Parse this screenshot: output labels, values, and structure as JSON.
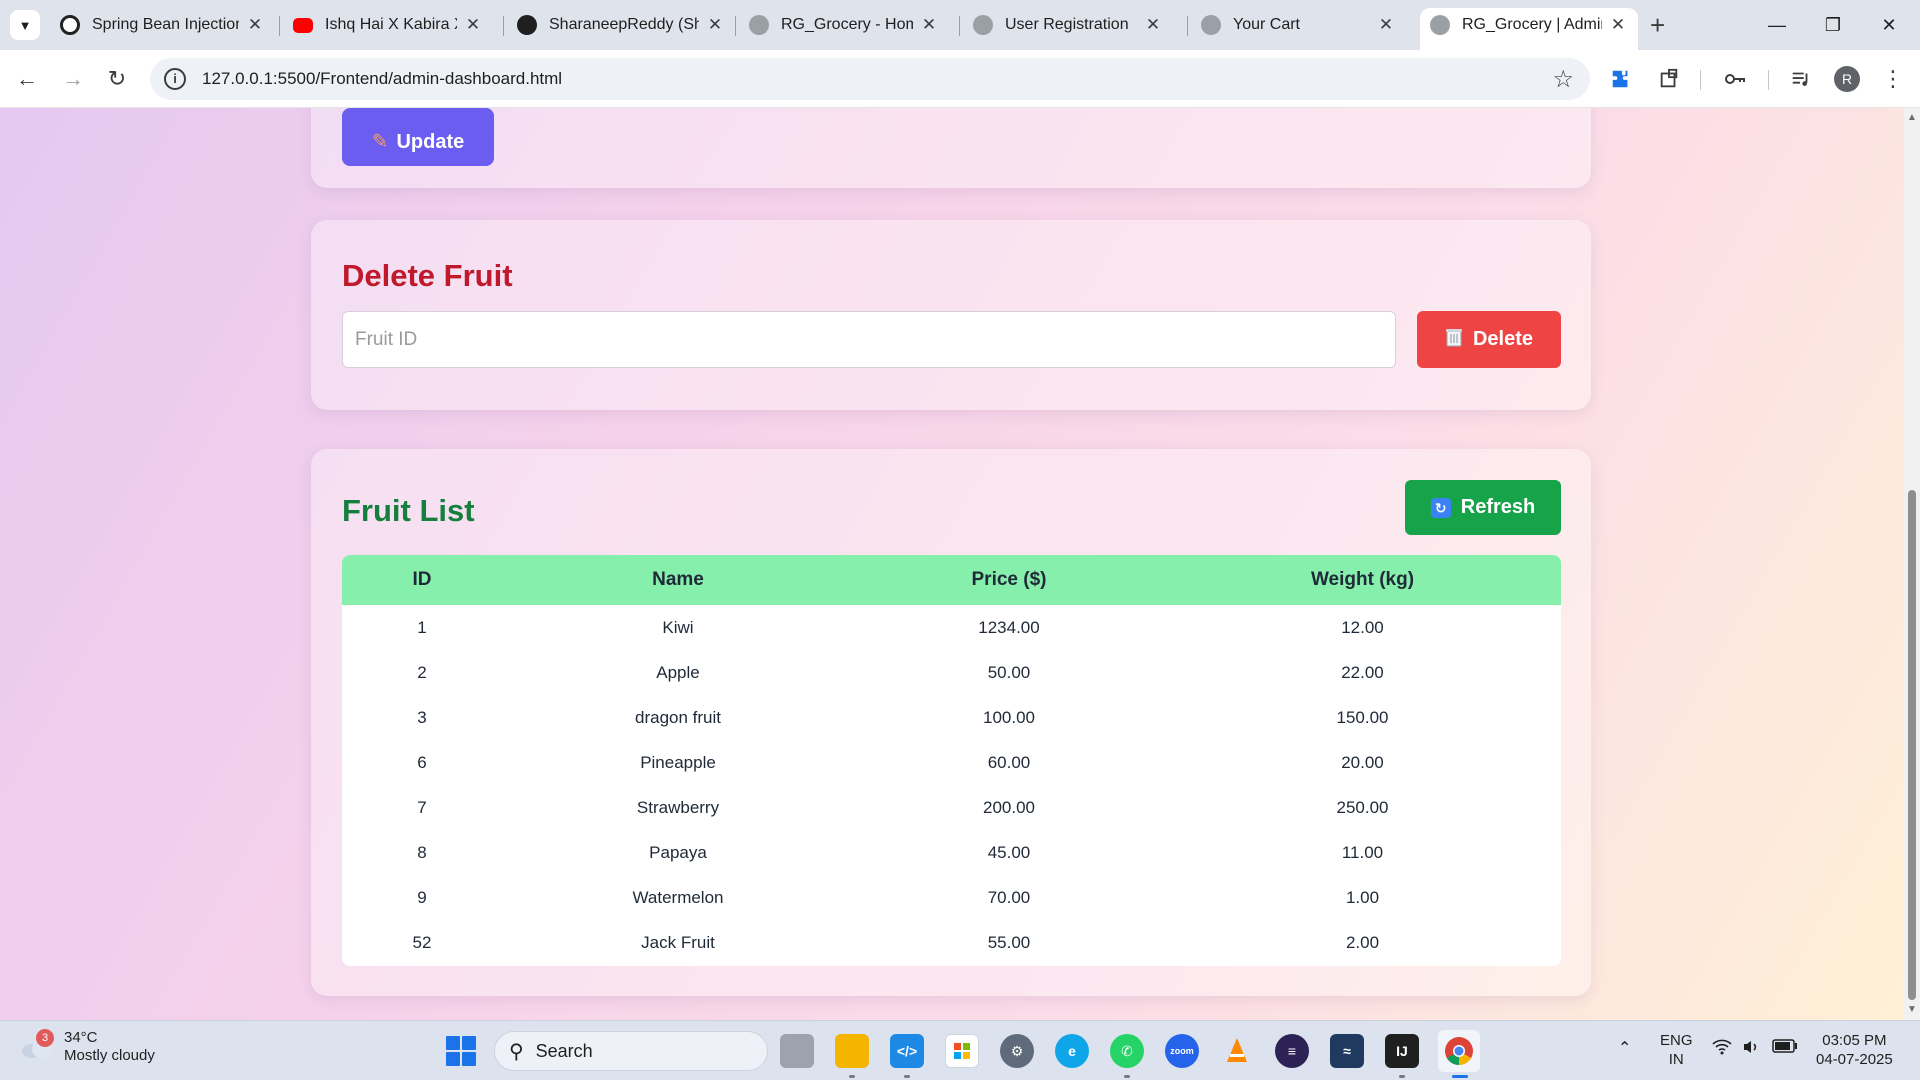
{
  "browser": {
    "tabs": [
      {
        "title": "Spring Bean Injection",
        "favicon": "openai-icon",
        "active": false
      },
      {
        "title": "Ishq Hai X Kabira X V",
        "favicon": "youtube-icon",
        "active": false
      },
      {
        "title": "SharaneepReddy (Sh",
        "favicon": "github-icon",
        "active": false
      },
      {
        "title": "RG_Grocery - Home",
        "favicon": "globe-icon",
        "active": false
      },
      {
        "title": "User Registration",
        "favicon": "globe-icon",
        "active": false
      },
      {
        "title": "Your Cart",
        "favicon": "globe-icon",
        "active": false
      },
      {
        "title": "RG_Grocery | Admin",
        "favicon": "globe-icon",
        "active": true
      }
    ],
    "url": "127.0.0.1:5500/Frontend/admin-dashboard.html",
    "profile_initial": "R"
  },
  "page": {
    "update_button_label": "Update",
    "delete_section": {
      "title": "Delete Fruit",
      "input_placeholder": "Fruit ID",
      "input_value": "",
      "button_label": "Delete"
    },
    "fruit_list": {
      "title": "Fruit List",
      "refresh_label": "Refresh",
      "columns": [
        "ID",
        "Name",
        "Price ($)",
        "Weight (kg)"
      ],
      "rows": [
        {
          "id": "1",
          "name": "Kiwi",
          "price": "1234.00",
          "weight": "12.00"
        },
        {
          "id": "2",
          "name": "Apple",
          "price": "50.00",
          "weight": "22.00"
        },
        {
          "id": "3",
          "name": "dragon fruit",
          "price": "100.00",
          "weight": "150.00"
        },
        {
          "id": "6",
          "name": "Pineapple",
          "price": "60.00",
          "weight": "20.00"
        },
        {
          "id": "7",
          "name": "Strawberry",
          "price": "200.00",
          "weight": "250.00"
        },
        {
          "id": "8",
          "name": "Papaya",
          "price": "45.00",
          "weight": "11.00"
        },
        {
          "id": "9",
          "name": "Watermelon",
          "price": "70.00",
          "weight": "1.00"
        },
        {
          "id": "52",
          "name": "Jack Fruit",
          "price": "55.00",
          "weight": "2.00"
        }
      ]
    },
    "colors": {
      "update": "#6a5df0",
      "delete_title": "#c0192b",
      "delete_button": "#ef4444",
      "list_title": "#15803d",
      "refresh_button": "#16a34a",
      "table_header": "#86efac"
    }
  },
  "taskbar": {
    "weather_temp": "34°C",
    "weather_desc": "Mostly cloudy",
    "weather_badge": "3",
    "search_label": "Search",
    "lang_top": "ENG",
    "lang_bottom": "IN",
    "time": "03:05 PM",
    "date": "04-07-2025"
  }
}
